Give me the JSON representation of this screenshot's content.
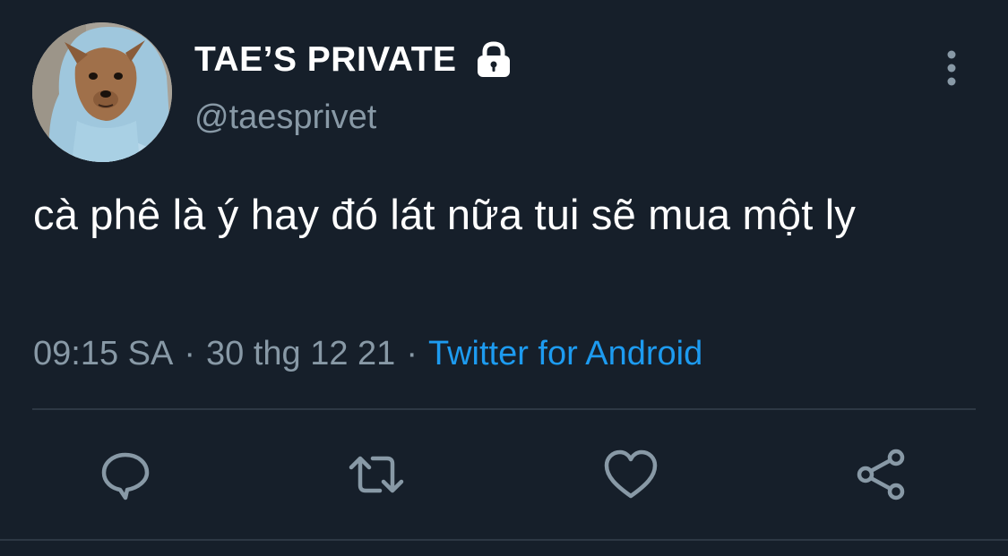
{
  "tweet": {
    "author": {
      "display_name": "TAE’S PRIVATE",
      "handle": "@taesprivet",
      "avatar_icon": "dog-in-hoodie-avatar",
      "protected_icon": "lock-icon"
    },
    "text": "cà phê là ý hay đó lát nữa tui sẽ mua một ly",
    "meta": {
      "time": "09:15 SA",
      "separator": "·",
      "date": "30 thg 12 21",
      "source": "Twitter for Android"
    },
    "actions": [
      {
        "name": "reply",
        "icon": "comment-icon"
      },
      {
        "name": "retweet",
        "icon": "retweet-icon"
      },
      {
        "name": "like",
        "icon": "heart-icon"
      },
      {
        "name": "share",
        "icon": "share-icon"
      }
    ],
    "more_icon": "more-vertical-icon"
  },
  "colors": {
    "background": "#161f2a",
    "primary_text": "#ffffff",
    "secondary_text": "#8899a6",
    "accent": "#1d9bf0",
    "divider": "#2d3844"
  }
}
